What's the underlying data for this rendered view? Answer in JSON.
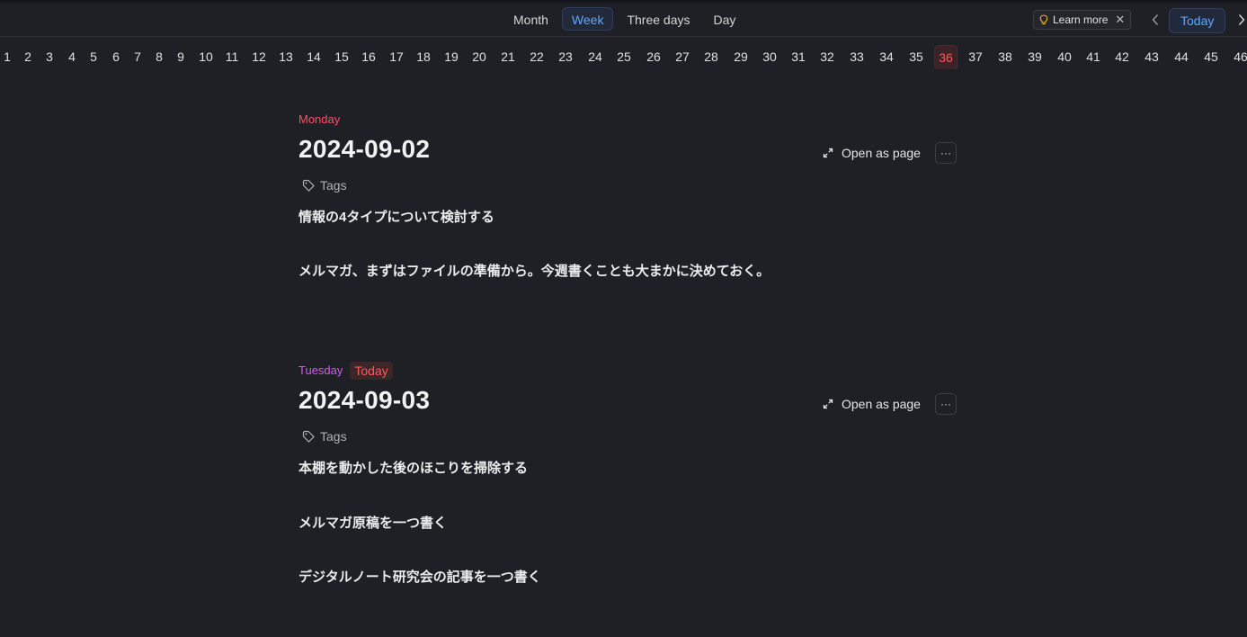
{
  "toolbar": {
    "tabs": [
      "Month",
      "Week",
      "Three days",
      "Day"
    ],
    "active_tab": "Week",
    "learn_more_label": "Learn more",
    "today_label": "Today",
    "accent_color": "#5ea8ff"
  },
  "weeks": {
    "numbers": [
      "1",
      "2",
      "3",
      "4",
      "5",
      "6",
      "7",
      "8",
      "9",
      "10",
      "11",
      "12",
      "13",
      "14",
      "15",
      "16",
      "17",
      "18",
      "19",
      "20",
      "21",
      "22",
      "23",
      "24",
      "25",
      "26",
      "27",
      "28",
      "29",
      "30",
      "31",
      "32",
      "33",
      "34",
      "35",
      "36",
      "37",
      "38",
      "39",
      "40",
      "41",
      "42",
      "43",
      "44",
      "45",
      "46"
    ],
    "current": "36"
  },
  "days": [
    {
      "weekday": "Monday",
      "date": "2024-09-02",
      "is_today": false,
      "open_as_page": "Open as page",
      "tags_label": "Tags",
      "notes": [
        "情報の4タイプについて検討する",
        "メルマガ、まずはファイルの準備から。今週書くことも大まかに決めておく。"
      ]
    },
    {
      "weekday": "Tuesday",
      "date": "2024-09-03",
      "is_today": true,
      "today_badge": "Today",
      "open_as_page": "Open as page",
      "tags_label": "Tags",
      "notes": [
        "本棚を動かした後のほこりを掃除する",
        "メルマガ原稿を一つ書く",
        "デジタルノート研究会の記事を一つ書く"
      ]
    }
  ]
}
